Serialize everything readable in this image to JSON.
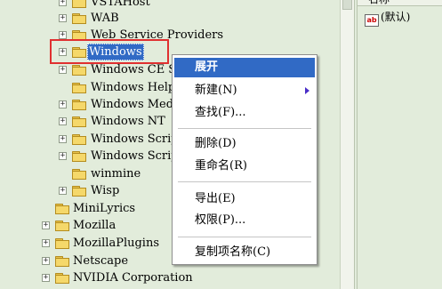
{
  "tree": {
    "nodes": [
      {
        "label": "VSTAHost"
      },
      {
        "label": "WAB"
      },
      {
        "label": "Web Service Providers"
      },
      {
        "label": "Windows"
      },
      {
        "label": "Windows CE Se"
      },
      {
        "label": "Windows Help"
      },
      {
        "label": "Windows Media"
      },
      {
        "label": "Windows NT"
      },
      {
        "label": "Windows Script"
      },
      {
        "label": "Windows Script"
      },
      {
        "label": "winmine"
      },
      {
        "label": "Wisp"
      },
      {
        "label": "MiniLyrics"
      },
      {
        "label": "Mozilla"
      },
      {
        "label": "MozillaPlugins"
      },
      {
        "label": "Netscape"
      },
      {
        "label": "NVIDIA Corporation"
      }
    ]
  },
  "right_pane": {
    "column_header": "名称",
    "value_icon": "ab",
    "value_name": "(默认)"
  },
  "context_menu": {
    "items": [
      {
        "label": "展开"
      },
      {
        "label": "新建(N)"
      },
      {
        "label": "查找(F)..."
      },
      {
        "label": "删除(D)"
      },
      {
        "label": "重命名(R)"
      },
      {
        "label": "导出(E)"
      },
      {
        "label": "权限(P)..."
      },
      {
        "label": "复制项名称(C)"
      }
    ]
  },
  "colors": {
    "tree_background": "#e2ecdb",
    "selection": "#316ac5",
    "annotation_box": "#e03030"
  }
}
